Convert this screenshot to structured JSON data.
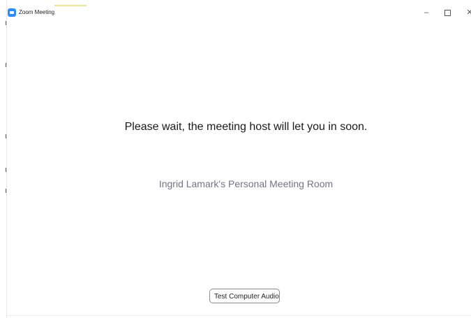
{
  "window": {
    "title": "Zoom Meeting",
    "minimize_glyph": "–",
    "close_glyph": "✕",
    "app_icon": "zoom-camera-icon"
  },
  "main": {
    "wait_message": "Please wait, the meeting host will let you in soon.",
    "room_name": "Ingrid Lamark's Personal Meeting Room"
  },
  "actions": {
    "test_audio_label": "Test Computer Audio"
  },
  "colors": {
    "accent": "#2d8cff",
    "room_name_text": "#747487"
  }
}
